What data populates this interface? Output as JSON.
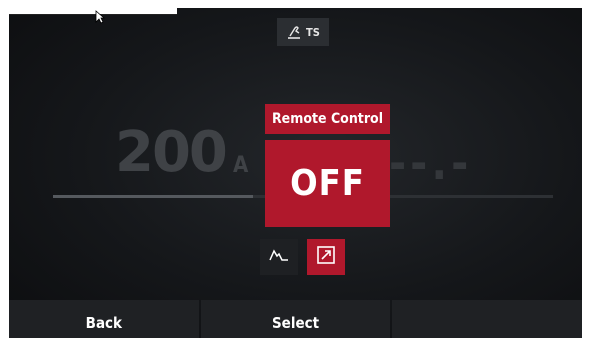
{
  "header": {
    "mode_label": "TS",
    "mode_icon": "welding-torch-icon"
  },
  "display": {
    "current_value": "200",
    "current_unit": "A",
    "voltage_value": "--.-",
    "slider_level": 0.4
  },
  "overlay": {
    "title": "Remote Control",
    "state": "OFF"
  },
  "function_buttons": [
    {
      "icon": "waveform-icon",
      "active": false
    },
    {
      "icon": "remote-arrow-icon",
      "active": true
    }
  ],
  "softkeys": {
    "back_label": "Back",
    "select_label": "Select",
    "third_label": ""
  },
  "colors": {
    "accent": "#b0182c",
    "background": "#15171a",
    "button": "#1f2124"
  }
}
